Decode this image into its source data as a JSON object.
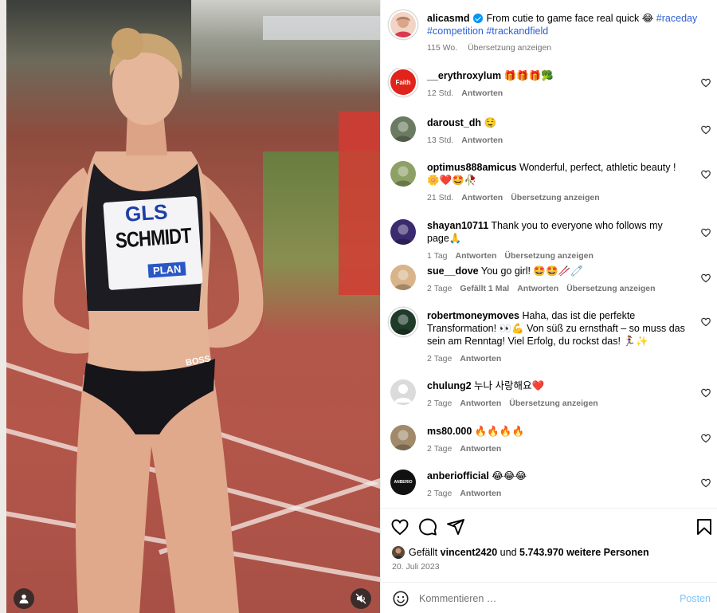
{
  "post": {
    "username": "alicasmd",
    "caption_text": "From cutie to game face real quick 😂",
    "hashtags": [
      "#raceday",
      "#competition",
      "#trackandfield"
    ],
    "age": "115 Wo.",
    "translate_label": "Übersetzung anzeigen"
  },
  "media": {
    "bib_sponsor": "GLS",
    "bib_name": "SCHMIDT",
    "bib_sub": "PLAN",
    "brief_brand": "BOSS"
  },
  "comments": [
    {
      "user": "__erythroxylum",
      "text": "🎁🎁🎁🥦",
      "time": "12 Std.",
      "likes": "",
      "reply": "Antworten",
      "translate": "",
      "avatar_color": "#e0241b",
      "avatar_text": "Faith",
      "ring": true
    },
    {
      "user": "daroust_dh",
      "text": "🤤",
      "time": "13 Std.",
      "likes": "",
      "reply": "Antworten",
      "translate": "",
      "avatar_color": "#6b7b62",
      "avatar_text": "",
      "ring": false
    },
    {
      "user": "optimus888amicus",
      "text": "Wonderful, perfect, athletic beauty ! 🌼❤️🤩🥀",
      "time": "21 Std.",
      "likes": "",
      "reply": "Antworten",
      "translate": "Übersetzung anzeigen",
      "avatar_color": "#8da066",
      "avatar_text": "",
      "ring": false
    },
    {
      "user": "shayan10711",
      "text": "Thank you to everyone who follows my page🙏",
      "time": "1 Tag",
      "likes": "",
      "reply": "Antworten",
      "translate": "Übersetzung anzeigen",
      "avatar_color": "#3b2a6e",
      "avatar_text": "",
      "ring": false
    },
    {
      "user": "sue__dove",
      "text": "You go girl! 🤩🤩🥢🧷",
      "time": "2 Tage",
      "likes": "Gefällt 1 Mal",
      "reply": "Antworten",
      "translate": "Übersetzung anzeigen",
      "avatar_color": "#d9b48a",
      "avatar_text": "",
      "ring": false
    },
    {
      "user": "robertmoneymoves",
      "text": "Haha, das ist die perfekte Transformation! 👀💪 Von süß zu ernsthaft – so muss das sein am Renntag! Viel Erfolg, du rockst das! 🏃‍♀️✨",
      "time": "2 Tage",
      "likes": "",
      "reply": "Antworten",
      "translate": "",
      "avatar_color": "#1f3b2a",
      "avatar_text": "",
      "ring": true
    },
    {
      "user": "chulung2",
      "text": "누나 사랑해요❤️",
      "time": "2 Tage",
      "likes": "",
      "reply": "Antworten",
      "translate": "Übersetzung anzeigen",
      "avatar_color": "#dbdbdb",
      "avatar_text": "",
      "ring": false
    },
    {
      "user": "ms80.000",
      "text": "🔥🔥🔥🔥",
      "time": "2 Tage",
      "likes": "",
      "reply": "Antworten",
      "translate": "",
      "avatar_color": "#a08a6a",
      "avatar_text": "",
      "ring": false
    },
    {
      "user": "anberiofficial",
      "text": "😂😂😂",
      "time": "2 Tage",
      "likes": "",
      "reply": "Antworten",
      "translate": "",
      "avatar_color": "#111111",
      "avatar_text": "ANBERIO",
      "ring": false
    }
  ],
  "footer": {
    "likes_prefix": "Gefällt ",
    "likes_user": "vincent2420",
    "likes_mid": " und ",
    "likes_count": "5.743.970 weitere Personen",
    "date": "20. Juli 2023",
    "comment_placeholder": "Kommentieren …",
    "post_label": "Posten"
  }
}
